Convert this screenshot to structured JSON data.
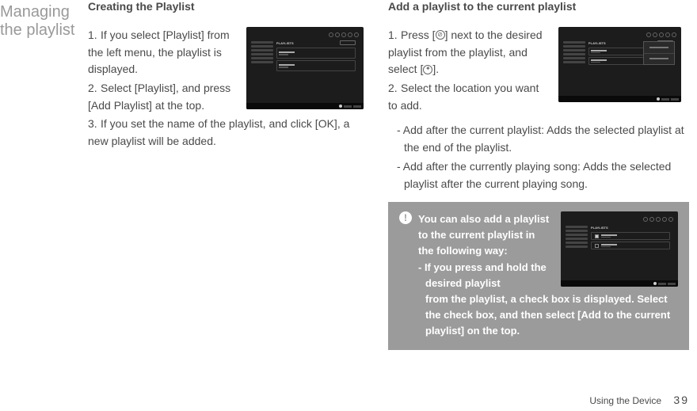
{
  "section_title_line1": "Managing",
  "section_title_line2": "the playlist",
  "left": {
    "heading": "Creating the Playlist",
    "items": [
      "If you select [Playlist] from the left menu, the playlist is displayed.",
      "Select [Playlist], and press [Add Playlist] at the top.",
      "If you set the name of the playlist, and click [OK], a new playlist will be added."
    ]
  },
  "right": {
    "heading": "Add a playlist to the current playlist",
    "item1_a": "Press [",
    "item1_b": "] next to the desired playlist from the playlist, and select [",
    "item1_c": "].",
    "item2": "Select the location you want to add.",
    "dash1": "- Add after the current playlist: Adds the selected playlist at the end of the playlist.",
    "dash2": "- Add after the currently playing song: Adds the selected playlist after the current playing song."
  },
  "info": {
    "lead": "You can also add a playlist to the current playlist in the following way:",
    "dash_start": "- If you press and hold the desired playlist",
    "dash_rest": "from the playlist, a check box is displayed. Select the check box, and then select [Add to the current playlist] on the top."
  },
  "footer": {
    "label": "Using the Device",
    "page": "39"
  },
  "thumb": {
    "playlists": "PLAYLISTS",
    "item1": "Demo List 0",
    "item2": "Demo List 1"
  }
}
